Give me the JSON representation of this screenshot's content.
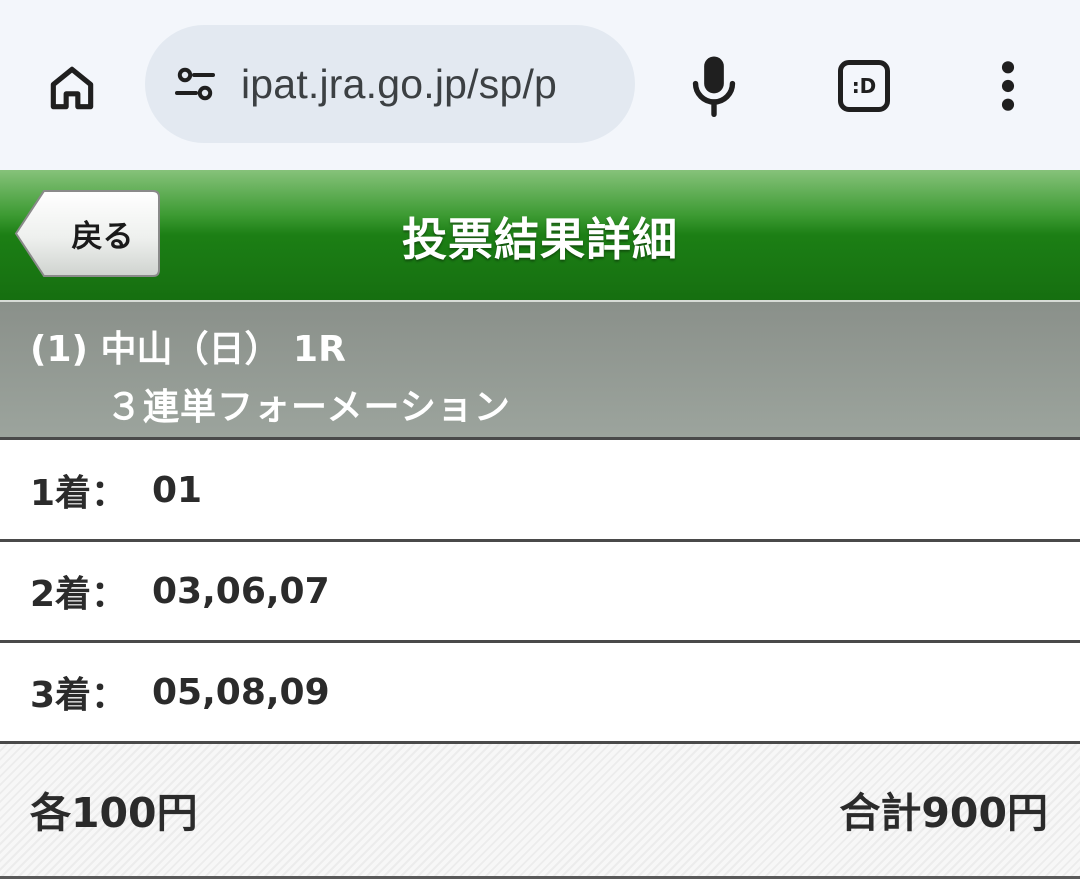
{
  "browser": {
    "url": "ipat.jra.go.jp/sp/p",
    "home_icon": "home-icon",
    "site_settings_icon": "tune-icon",
    "mic_icon": "mic-icon",
    "extension_label": ":D",
    "more_icon": "more-vert-icon"
  },
  "header": {
    "back_label": "戻る",
    "title": "投票結果詳細",
    "accent_color": "#1c7f15"
  },
  "race": {
    "line1": "(1) 中山（日） 1R",
    "bet_type": "３連単フォーメーション"
  },
  "picks": [
    {
      "label": "1着：",
      "value": "01"
    },
    {
      "label": "2着：",
      "value": "03,06,07"
    },
    {
      "label": "3着：",
      "value": "05,08,09"
    }
  ],
  "footer": {
    "unit_price": "各100円",
    "total_price": "合計900円"
  }
}
